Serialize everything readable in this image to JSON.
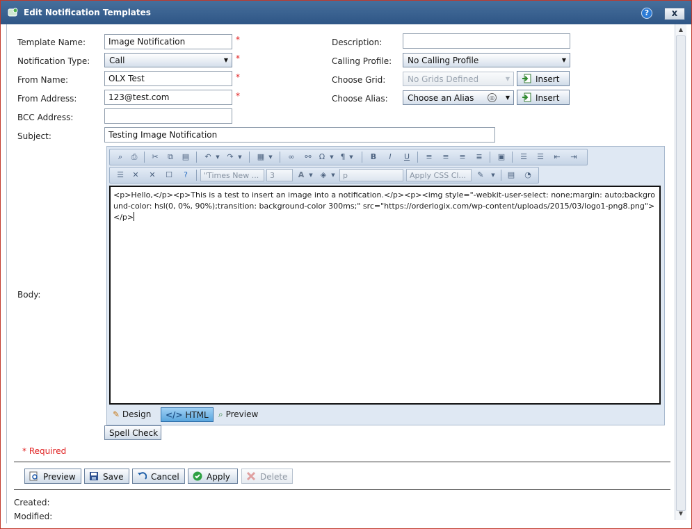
{
  "window": {
    "title": "Edit Notification Templates",
    "help": "?",
    "close": "x"
  },
  "form": {
    "template_name_label": "Template Name:",
    "template_name_value": "Image Notification",
    "notification_type_label": "Notification Type:",
    "notification_type_value": "Call",
    "from_name_label": "From Name:",
    "from_name_value": "OLX Test",
    "from_address_label": "From Address:",
    "from_address_value": "123@test.com",
    "bcc_label": "BCC Address:",
    "bcc_value": "",
    "subject_label": "Subject:",
    "subject_value": "Testing Image Notification",
    "body_label": "Body:",
    "description_label": "Description:",
    "description_value": "",
    "calling_profile_label": "Calling Profile:",
    "calling_profile_value": "No Calling Profile",
    "choose_grid_label": "Choose Grid:",
    "choose_grid_value": "No Grids Defined",
    "choose_alias_label": "Choose Alias:",
    "choose_alias_value": "Choose an Alias",
    "insert_label": "Insert",
    "required_mark": "*"
  },
  "editor": {
    "font_name": "\"Times New ...",
    "font_size": "3",
    "paragraph": "p",
    "css_class": "Apply CSS Cl...",
    "content": "<p>Hello,</p><p>This is a test to insert an image into a notification.</p><p><img style=\"-webkit-user-select: none;margin: auto;background-color: hsl(0, 0%, 90%);transition: background-color 300ms;\" src=\"https://orderlogix.com/wp-content/uploads/2015/03/logo1-png8.png\"></p>",
    "mode_design": "Design",
    "mode_html": "HTML",
    "mode_preview": "Preview",
    "spell_check": "Spell Check"
  },
  "required_note": "* Required",
  "actions": {
    "preview": "Preview",
    "save": "Save",
    "cancel": "Cancel",
    "apply": "Apply",
    "delete": "Delete"
  },
  "footer": {
    "created_label": "Created:",
    "modified_label": "Modified:"
  },
  "colors": {
    "title_bar": "#2f5686",
    "required": "#e02020",
    "active_tab": "#5aa6de"
  }
}
